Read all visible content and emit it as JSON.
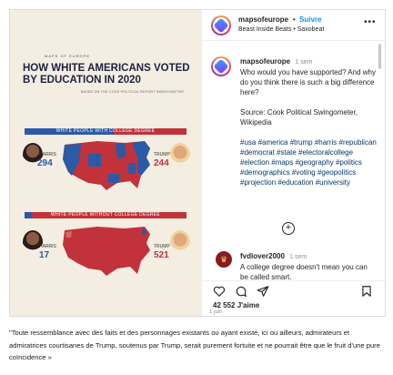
{
  "infographic": {
    "brand": "MAPS OF EUROPE",
    "title": "HOW WHITE AMERICANS VOTED BY EDUCATION IN 2020",
    "subtitle": "BASED ON THE COOK POLITICAL REPORT SWINGOMETER",
    "band1": "WHITE PEOPLE WITH COLLEGE DEGREE",
    "band2": "WHITE PEOPLE WITHOUT COLLEGE DEGREE",
    "harris_label": "HARRIS",
    "trump_label": "TRUMP",
    "college": {
      "harris": "294",
      "trump": "244"
    },
    "no_college": {
      "harris": "17",
      "trump": "521"
    }
  },
  "post": {
    "username": "mapsofeurope",
    "follow": "Suivre",
    "music": "Beast Inside Beats • Saxobeat",
    "caption_user": "mapsofeurope",
    "caption_time": "1 sem",
    "caption_text": "Who would you have supported? And why do you think there is such a big difference here?",
    "source": "Source: Cook Political Swingometer, Wikipedia",
    "hashtags": "#usa #america #trump #harris #republican #democrat #state #electoralcollege #election #maps #geography #politics #demographics #voting #geopolitics #projection #education #university",
    "comment_user": "fvdlover2000",
    "comment_time": "1 sem",
    "comment_text": "A college degree doesn't mean you can be called smart.",
    "likes": "42 552 J'aime",
    "date": "1 juin"
  },
  "quote": "\"Toute ressemblance avec des faits et des personnages existants ou ayant existé, ici ou ailleurs, admirateurs et admiratrices courtisanes de Trump, soutenus par Trump, serait purement fortuite et ne pourrait être que le fruit d'une pure coïncidence »",
  "colors": {
    "democrat": "#2b5aa6",
    "republican": "#c2323b",
    "link": "#0095f6"
  }
}
